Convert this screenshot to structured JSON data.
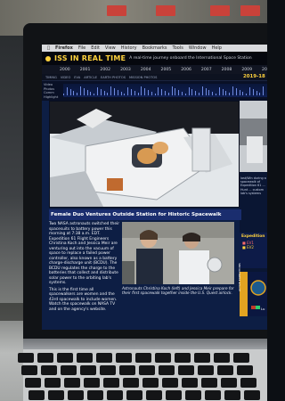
{
  "menubar": {
    "app": "Firefox",
    "items": [
      "File",
      "Edit",
      "View",
      "History",
      "Bookmarks",
      "Tools",
      "Window",
      "Help"
    ]
  },
  "site": {
    "title": "ISS IN REAL TIME",
    "tagline": "A real-time journey onboard the International Space Station",
    "years": [
      "2000",
      "2001",
      "2002",
      "2003",
      "2004",
      "2005",
      "2006",
      "2007",
      "2008",
      "2009",
      "2010"
    ],
    "nav": [
      "TIMING",
      "VIDEO",
      "EVA",
      "ARTICLE",
      "EARTH PHOTOS",
      "MISSION PHOTOS"
    ],
    "timeline_labels": [
      "Video",
      "Photos",
      "Comm",
      "Highlight"
    ],
    "current_date": "2019-18"
  },
  "article": {
    "headline": "Female Duo Ventures Outside Station for Historic Spacewalk",
    "body": "Two NASA astronauts switched their spacesuits to battery power this morning at 7:38 a.m. EDT. Expedition 61 Flight Engineers Christina Koch and Jessica Meir are venturing out into the vacuum of space to replace a failed power controller, also known as a battery charge-discharge unit (BCDU). The BCDU regulates the charge to the batteries that collect and distribute solar power to the orbiting lab's systems.",
    "body2": "This is the first time all spacewalkers are women and the 43rd spacewalk to include women. Watch the spacewalk on NASA TV and on the agency's website.",
    "caption": "Astronauts Christina Koch (left) and Jessica Meir prepare for their first spacewalk together inside the U.S. Quest airlock."
  },
  "right_panel": {
    "snippet": "lost/Win during a spacewalk of Expedition 61 ... Hunt ... custom lab's systems",
    "label_expedition": "Expedition",
    "eva_rows": [
      "EV1",
      "EV2"
    ],
    "vertical_label": "ACTIVE EXPEDITIONS",
    "lu_label": "Lu"
  }
}
